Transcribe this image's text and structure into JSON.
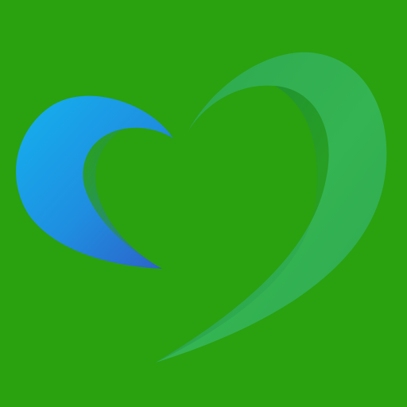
{
  "background_color": "#2aa10f",
  "logo": {
    "icon": "heart-swoosh-icon",
    "colors": {
      "blue_light": "#14b2ee",
      "blue_mid": "#1f8ee0",
      "blue_dark": "#2d5fc8",
      "green_light": "#35b453",
      "green_mid": "#2ca84f",
      "green_dark": "#137f3a"
    }
  }
}
